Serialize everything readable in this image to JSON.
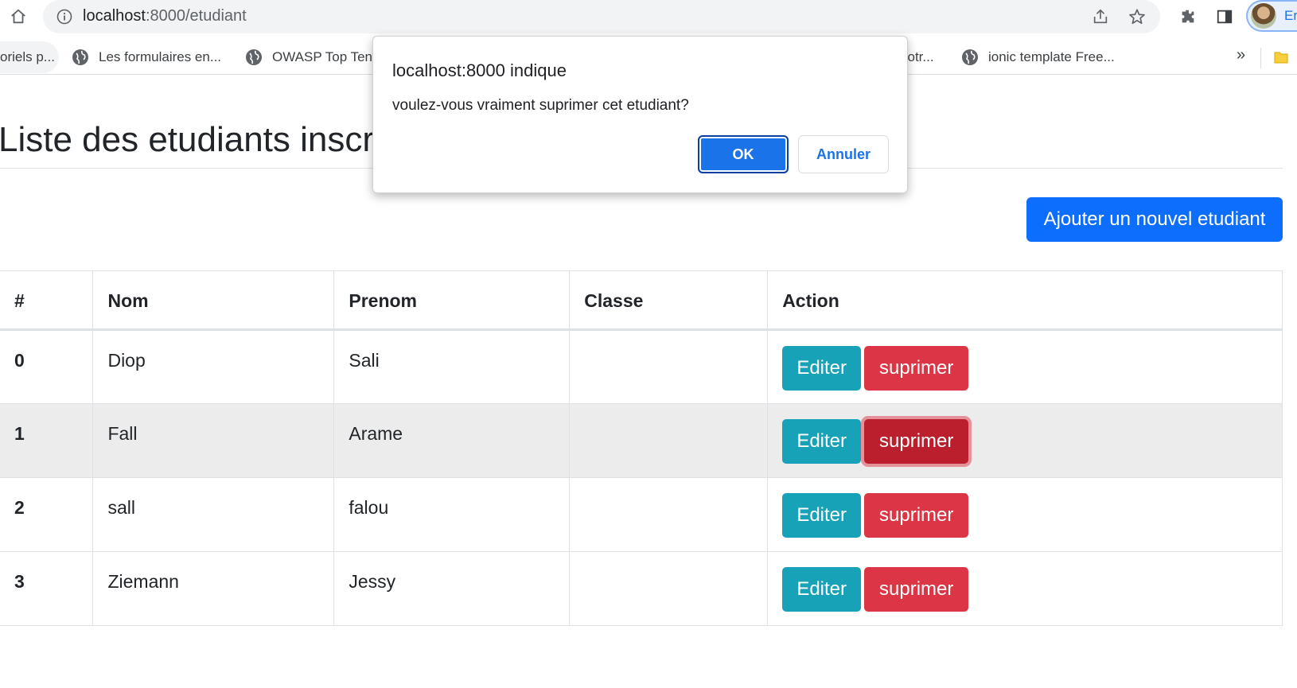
{
  "browser": {
    "url_host": "localhost",
    "url_path": ":8000/etudiant",
    "profile_label": "Er",
    "bookmarks": [
      {
        "label": "oriels p..."
      },
      {
        "label": "Les formulaires en..."
      },
      {
        "label": "OWASP Top Ten"
      },
      {
        "label": "votr..."
      },
      {
        "label": "ionic template Free..."
      }
    ],
    "more_label": "»"
  },
  "page": {
    "title": "Liste des etudiants inscrits",
    "add_button": "Ajouter un nouvel etudiant"
  },
  "table": {
    "headers": [
      "#",
      "Nom",
      "Prenom",
      "Classe",
      "Action"
    ],
    "edit_label": "Editer",
    "delete_label": "suprimer",
    "rows": [
      {
        "id": "0",
        "nom": "Diop",
        "prenom": "Sali",
        "classe": ""
      },
      {
        "id": "1",
        "nom": "Fall",
        "prenom": "Arame",
        "classe": ""
      },
      {
        "id": "2",
        "nom": "sall",
        "prenom": "falou",
        "classe": ""
      },
      {
        "id": "3",
        "nom": "Ziemann",
        "prenom": "Jessy",
        "classe": ""
      }
    ]
  },
  "dialog": {
    "title": "localhost:8000 indique",
    "message": "voulez-vous vraiment suprimer cet etudiant?",
    "ok_label": "OK",
    "cancel_label": "Annuler"
  },
  "colors": {
    "primary": "#0d6efd",
    "info": "#17a2b8",
    "danger": "#dc3545",
    "danger_active": "#bb1e2d",
    "dialog_accent": "#1a73e8",
    "highlight_row": "#ececec"
  }
}
